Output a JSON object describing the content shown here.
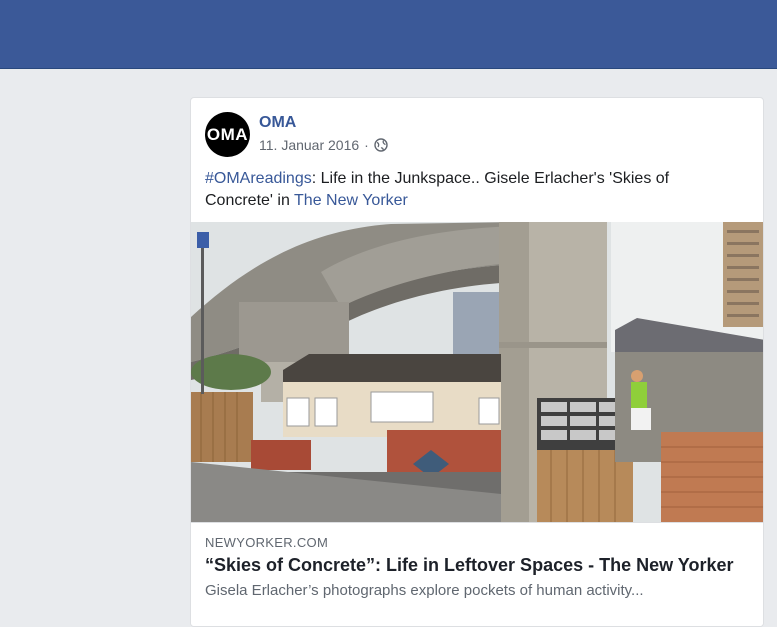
{
  "post": {
    "avatar_text": "OMA",
    "page_name": "OMA",
    "date": "11. Januar 2016",
    "separator": "·",
    "privacy_icon": "globe-icon",
    "text_hashtag": "#OMAreadings",
    "text_body": ": Life in the Junkspace.. Gisele Erlacher's 'Skies of Concrete' in ",
    "text_link": "The New Yorker"
  },
  "link_preview": {
    "domain": "NEWYORKER.COM",
    "title": "“Skies of Concrete”: Life in Leftover Spaces - The New Yorker",
    "description": "Gisela Erlacher’s photographs explore pockets of human activity..."
  },
  "colors": {
    "header": "#3b5998",
    "background": "#e9ebee",
    "link": "#385898"
  }
}
